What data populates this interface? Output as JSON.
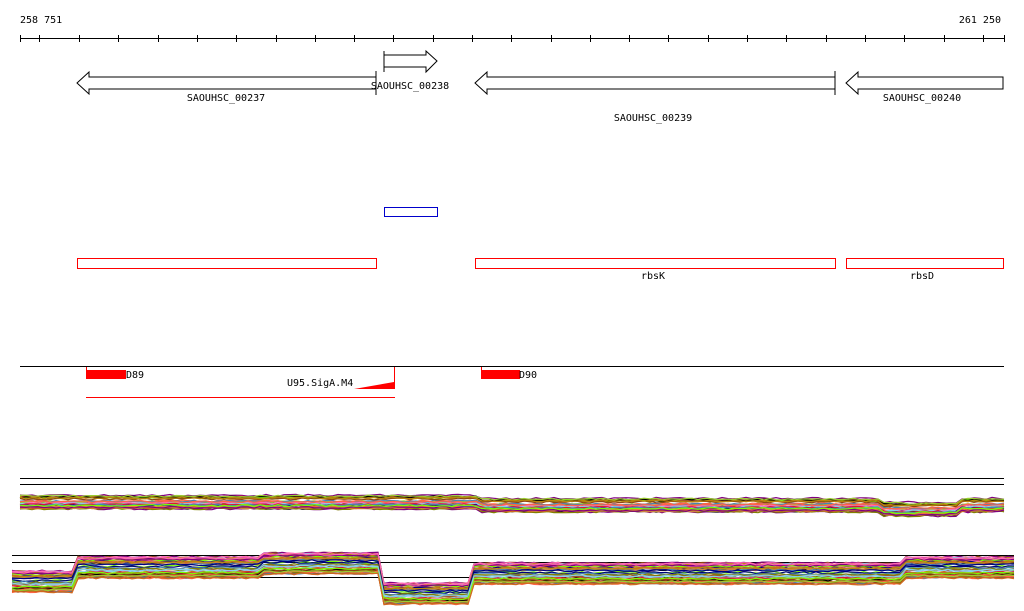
{
  "ruler": {
    "start_label": "258 751",
    "end_label": "261 250"
  },
  "genes": [
    {
      "name": "SAOUHSC_00237",
      "strand": "-"
    },
    {
      "name": "SAOUHSC_00238",
      "strand": "+"
    },
    {
      "name": "SAOUHSC_00239",
      "strand": "-"
    },
    {
      "name": "SAOUHSC_00240",
      "strand": "-"
    }
  ],
  "annotations": [
    {
      "name": "rbsK"
    },
    {
      "name": "rbsD"
    }
  ],
  "regulatory": [
    {
      "label": "D89"
    },
    {
      "label": "U95.SigA.M4"
    },
    {
      "label": "D90"
    }
  ],
  "colors": {
    "gene_outline": "#000000",
    "operon": "#ff0000",
    "small_feature": "#0000cc",
    "feature_fill": "#ff0000"
  }
}
